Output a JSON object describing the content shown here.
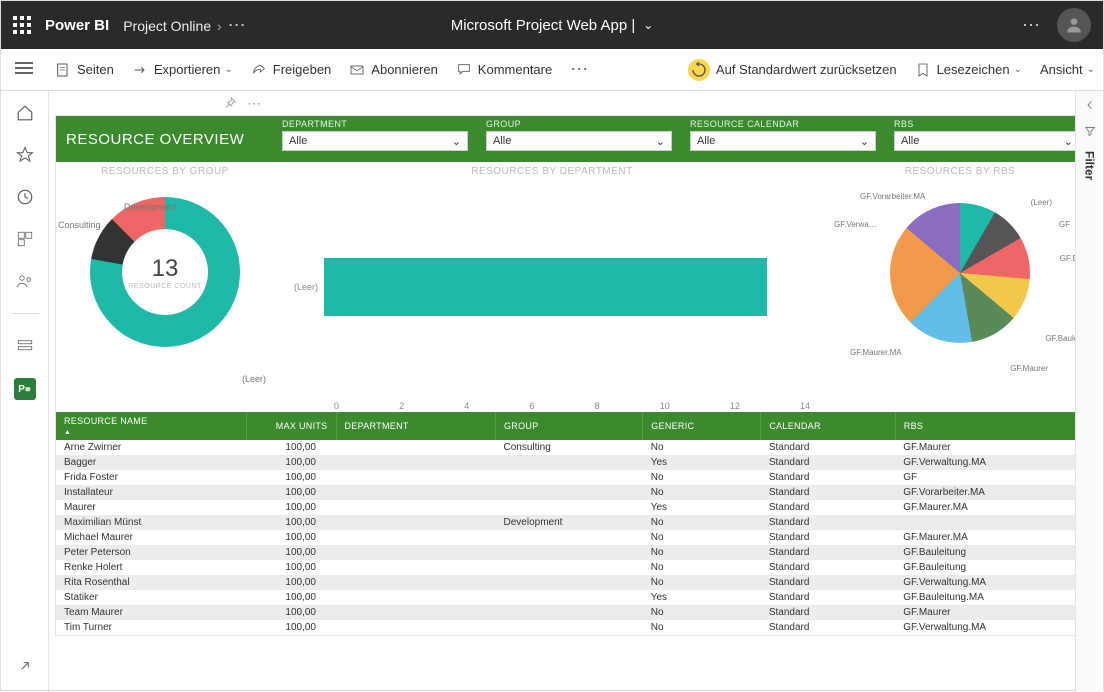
{
  "topbar": {
    "brand": "Power BI",
    "breadcrumb": "Project Online",
    "center": "Microsoft Project Web App  |"
  },
  "toolbar": {
    "seiten": "Seiten",
    "exportieren": "Exportieren",
    "freigeben": "Freigeben",
    "abonnieren": "Abonnieren",
    "kommentare": "Kommentare",
    "reset": "Auf Standardwert zurücksetzen",
    "lesezeichen": "Lesezeichen",
    "ansicht": "Ansicht"
  },
  "filter_tab": "Filter",
  "report": {
    "title": "RESOURCE OVERVIEW",
    "filters": {
      "department": {
        "label": "DEPARTMENT",
        "value": "Alle"
      },
      "group": {
        "label": "GROUP",
        "value": "Alle"
      },
      "calendar": {
        "label": "RESOURCE CALENDAR",
        "value": "Alle"
      },
      "rbs": {
        "label": "RBS",
        "value": "Alle"
      }
    },
    "charts": {
      "by_group_title": "RESOURCES BY GROUP",
      "by_dept_title": "RESOURCES BY DEPARTMENT",
      "by_rbs_title": "RESOURCES BY RBS",
      "donut_center_num": "13",
      "donut_center_lbl": "RESOURCE COUNT",
      "donut_labels": {
        "dev": "Development",
        "cons": "Consulting",
        "leer": "(Leer)"
      },
      "bar_row_label": "(Leer)",
      "bar_axis": [
        "0",
        "2",
        "4",
        "6",
        "8",
        "10",
        "12",
        "14"
      ],
      "pie_labels": {
        "vorarbeiter": "GF.Vorarbeiter.MA",
        "verwa": "GF.Verwa…",
        "maurer_ma": "GF.Maurer.MA",
        "maurer": "GF.Maurer",
        "baulei": "GF.Baulei…",
        "ba": "GF.Ba…",
        "gf": "GF",
        "leer": "(Leer)"
      }
    },
    "table": {
      "headers": [
        "RESOURCE NAME",
        "MAX UNITS",
        "DEPARTMENT",
        "GROUP",
        "GENERIC",
        "CALENDAR",
        "RBS"
      ],
      "rows": [
        [
          "Arne Zwirner",
          "100,00",
          "",
          "Consulting",
          "No",
          "Standard",
          "GF.Maurer"
        ],
        [
          "Bagger",
          "100,00",
          "",
          "",
          "Yes",
          "Standard",
          "GF.Verwaltung.MA"
        ],
        [
          "Frida Foster",
          "100,00",
          "",
          "",
          "No",
          "Standard",
          "GF"
        ],
        [
          "Installateur",
          "100,00",
          "",
          "",
          "No",
          "Standard",
          "GF.Vorarbeiter.MA"
        ],
        [
          "Maurer",
          "100,00",
          "",
          "",
          "Yes",
          "Standard",
          "GF.Maurer.MA"
        ],
        [
          "Maximilian Münst",
          "100,00",
          "",
          "Development",
          "No",
          "Standard",
          ""
        ],
        [
          "Michael Maurer",
          "100,00",
          "",
          "",
          "No",
          "Standard",
          "GF.Maurer.MA"
        ],
        [
          "Peter Peterson",
          "100,00",
          "",
          "",
          "No",
          "Standard",
          "GF.Bauleitung"
        ],
        [
          "Renke Holert",
          "100,00",
          "",
          "",
          "No",
          "Standard",
          "GF.Bauleitung"
        ],
        [
          "Rita Rosenthal",
          "100,00",
          "",
          "",
          "No",
          "Standard",
          "GF.Verwaltung.MA"
        ],
        [
          "Statiker",
          "100,00",
          "",
          "",
          "Yes",
          "Standard",
          "GF.Bauleitung.MA"
        ],
        [
          "Team Maurer",
          "100,00",
          "",
          "",
          "No",
          "Standard",
          "GF.Maurer"
        ],
        [
          "Tim Turner",
          "100,00",
          "",
          "",
          "No",
          "Standard",
          "GF.Verwaltung.MA"
        ]
      ]
    }
  },
  "chart_data": [
    {
      "type": "pie",
      "title": "RESOURCES BY GROUP",
      "center_value": 13,
      "center_label": "RESOURCE COUNT",
      "series": [
        {
          "name": "(Leer)",
          "value": 11
        },
        {
          "name": "Consulting",
          "value": 1
        },
        {
          "name": "Development",
          "value": 1
        }
      ]
    },
    {
      "type": "bar",
      "title": "RESOURCES BY DEPARTMENT",
      "orientation": "horizontal",
      "categories": [
        "(Leer)"
      ],
      "values": [
        13
      ],
      "xlim": [
        0,
        14
      ],
      "xticks": [
        0,
        2,
        4,
        6,
        8,
        10,
        12,
        14
      ]
    },
    {
      "type": "pie",
      "title": "RESOURCES BY RBS",
      "series": [
        {
          "name": "(Leer)",
          "value": 1
        },
        {
          "name": "GF",
          "value": 1
        },
        {
          "name": "GF.Ba…",
          "value": 1
        },
        {
          "name": "GF.Baulei…",
          "value": 2
        },
        {
          "name": "GF.Maurer",
          "value": 2
        },
        {
          "name": "GF.Maurer.MA",
          "value": 2
        },
        {
          "name": "GF.Verwa…",
          "value": 3
        },
        {
          "name": "GF.Vorarbeiter.MA",
          "value": 1
        }
      ]
    }
  ]
}
